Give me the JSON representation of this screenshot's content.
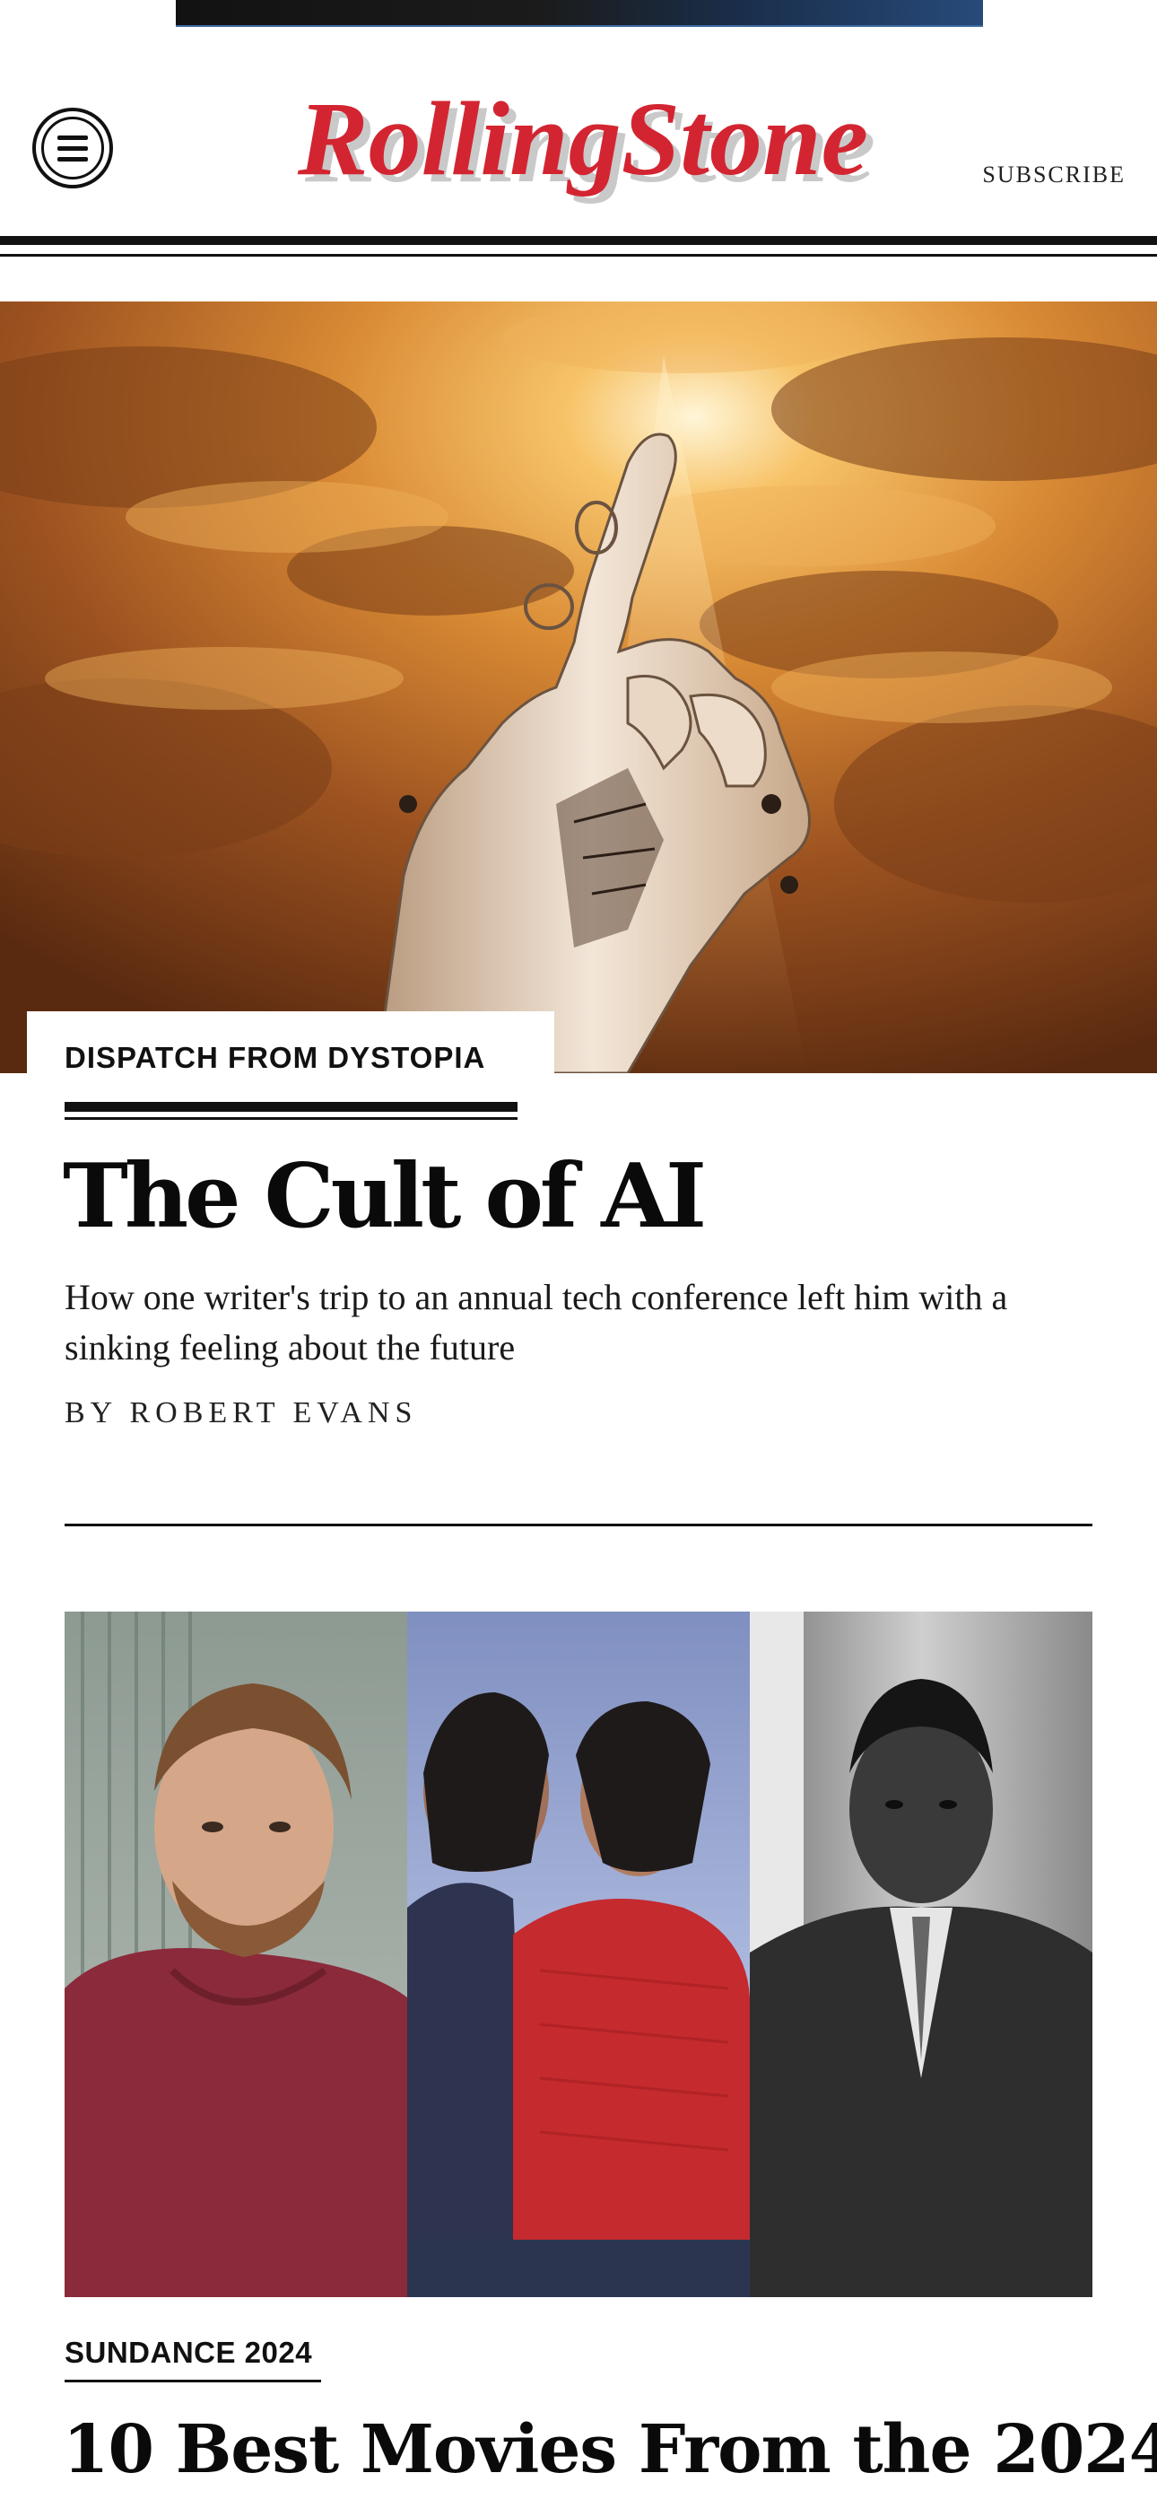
{
  "header": {
    "logo_text": "RollingStone",
    "subscribe_label": "SUBSCRIBE",
    "menu_icon": "hamburger-menu-icon",
    "brand_color": "#d32531"
  },
  "hero": {
    "image_alt": "Robotic hand pointing upward against golden sunlit clouds",
    "kicker": "DISPATCH FROM DYSTOPIA",
    "title": "The Cult of AI",
    "dek": "How one writer's trip to an annual tech conference left him with a sinking feeling about the future",
    "byline": "BY ROBERT EVANS"
  },
  "story2": {
    "image_alt": "Triptych of film stills: man in maroon hoodie, two women in profile, man in suit in black and white",
    "kicker": "SUNDANCE 2024",
    "title": "10 Best Movies From the 2024"
  }
}
